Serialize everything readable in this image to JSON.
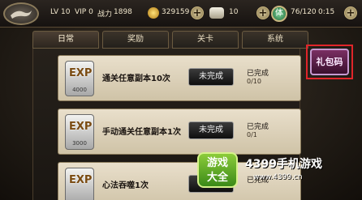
{
  "topbar": {
    "level": "LV 10",
    "vip": "VIP 0",
    "power_label": "战力",
    "power_value": "1898",
    "gold": "329159",
    "ingot": "10",
    "jade_glyph": "体",
    "stamina": "76/120",
    "timer": "0:15"
  },
  "tabs": [
    {
      "label": "日常",
      "active": true
    },
    {
      "label": "奖励",
      "active": false
    },
    {
      "label": "关卡",
      "active": false
    },
    {
      "label": "系统",
      "active": false
    }
  ],
  "gift_code": {
    "label": "礼包码",
    "highlight_color": "#e0252a"
  },
  "tasks": [
    {
      "badge": "EXP",
      "amount": "4000",
      "title": "通关任意副本10次",
      "button": "未完成",
      "status": "已完成",
      "progress": "0/10"
    },
    {
      "badge": "EXP",
      "amount": "3000",
      "title": "手动通关任意副本1次",
      "button": "未完成",
      "status": "已完成",
      "progress": "0/1"
    },
    {
      "badge": "EXP",
      "amount": "",
      "title": "心法吞噬1次",
      "button": "未完成",
      "status": "已完成",
      "progress": ""
    }
  ],
  "watermark": {
    "badge_line1": "游戏",
    "badge_line2": "大全",
    "title": "4399手机游戏",
    "url": "www.4399.cn"
  }
}
